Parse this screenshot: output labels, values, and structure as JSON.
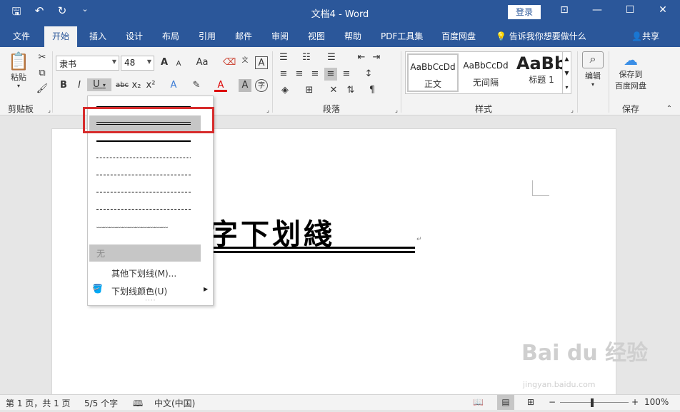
{
  "window": {
    "title": "文档4  -  Word",
    "login_label": "登录",
    "share_label": "共享",
    "tell_me": "告诉我你想要做什么"
  },
  "tabs": [
    {
      "label": "文件"
    },
    {
      "label": "开始"
    },
    {
      "label": "插入"
    },
    {
      "label": "设计"
    },
    {
      "label": "布局"
    },
    {
      "label": "引用"
    },
    {
      "label": "邮件"
    },
    {
      "label": "审阅"
    },
    {
      "label": "视图"
    },
    {
      "label": "帮助"
    },
    {
      "label": "PDF工具集"
    },
    {
      "label": "百度网盘"
    }
  ],
  "ribbon": {
    "paste_label": "粘贴",
    "clipboard_label": "剪贴板",
    "font_name": "隶书",
    "font_size": "48",
    "paragraph_label": "段落",
    "styles_label": "样式",
    "edit_label": "编辑",
    "save_baidu_line1": "保存到",
    "save_baidu_line2": "百度网盘",
    "save_label": "保存",
    "bold": "B",
    "italic": "I",
    "underline": "U",
    "strike": "abc",
    "subscript": "x₂",
    "superscript": "x²",
    "grow": "A",
    "case": "Aa",
    "styles": [
      {
        "preview": "AaBbCcDd",
        "name": "正文"
      },
      {
        "preview": "AaBbCcDd",
        "name": "无间隔"
      },
      {
        "preview": "AaBb",
        "name": "标题 1"
      }
    ]
  },
  "document": {
    "text": "字下划綫"
  },
  "dropdown": {
    "none_label": "无",
    "more_label": "其他下划线(M)...",
    "color_label": "下划线颜色(U)"
  },
  "status": {
    "page": "第 1 页，共 1 页",
    "words": "5/5 个字",
    "lang": "中文(中国)",
    "zoom": "100%"
  },
  "watermark": {
    "text": "Bai du 经验",
    "sub": "jingyan.baidu.com"
  },
  "colors": {
    "accent": "#2b579a",
    "highlight": "#c6c6c6",
    "callout": "#d72c2c"
  }
}
